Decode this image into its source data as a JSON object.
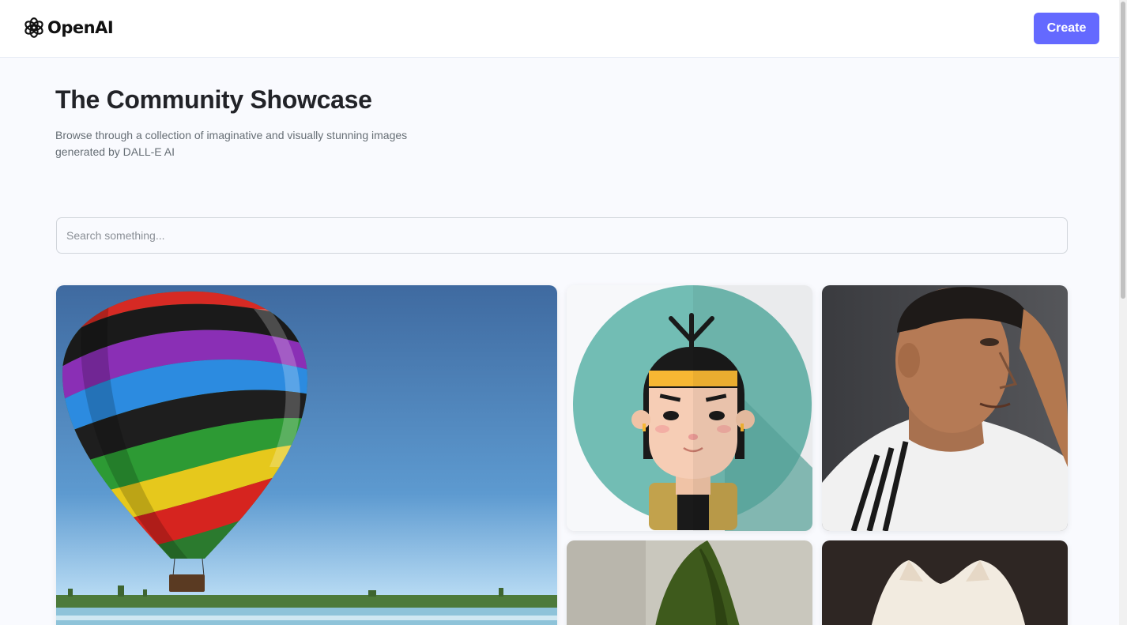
{
  "header": {
    "brand": "OpenAI",
    "brand_icon": "openai-logo-icon",
    "create_label": "Create",
    "accent_color": "#6469ff"
  },
  "hero": {
    "title": "The Community Showcase",
    "subtitle": "Browse through a collection of imaginative and visually stunning images generated by DALL-E AI"
  },
  "search": {
    "placeholder": "Search something...",
    "value": ""
  },
  "gallery": {
    "images": [
      {
        "subject": "rainbow-striped hot air balloon over a lake"
      },
      {
        "subject": "flat illustration avatar of a boy with a yellow headband"
      },
      {
        "subject": "photo of a footballer in a white striped shirt"
      },
      {
        "subject": "green pointed hat"
      },
      {
        "subject": "fluffy white cat"
      }
    ]
  }
}
